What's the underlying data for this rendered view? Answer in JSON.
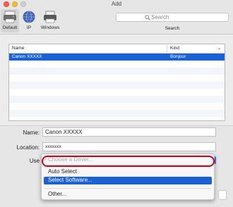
{
  "window": {
    "title": "Add"
  },
  "toolbar": {
    "tools": [
      {
        "label": "Default",
        "icon": "default-printer-icon"
      },
      {
        "label": "IP",
        "icon": "globe-icon"
      },
      {
        "label": "Windows",
        "icon": "windows-printer-icon"
      }
    ],
    "search": {
      "placeholder": "Search",
      "label": "Search",
      "icon": "magnifier-icon"
    }
  },
  "printer_list": {
    "columns": [
      "Name",
      "Kind"
    ],
    "rows": [
      {
        "name": "Canon XXXXX",
        "kind": "Bonjour",
        "selected": true
      }
    ]
  },
  "form": {
    "name_label": "Name:",
    "name_value": "Canon XXXXX",
    "location_label": "Location:",
    "location_value": "xxxxxxx",
    "use_label": "Use"
  },
  "use_menu": {
    "items": [
      {
        "label": "Choose a Driver...",
        "checked": true,
        "disabled": true
      },
      {
        "label": "Auto Select"
      },
      {
        "label": "Select Software...",
        "highlighted": true
      },
      {
        "label": "Other..."
      }
    ]
  },
  "colors": {
    "selection": "#1a61d6",
    "highlight_ring": "#d0021b",
    "accent": "#2a7bf0"
  }
}
